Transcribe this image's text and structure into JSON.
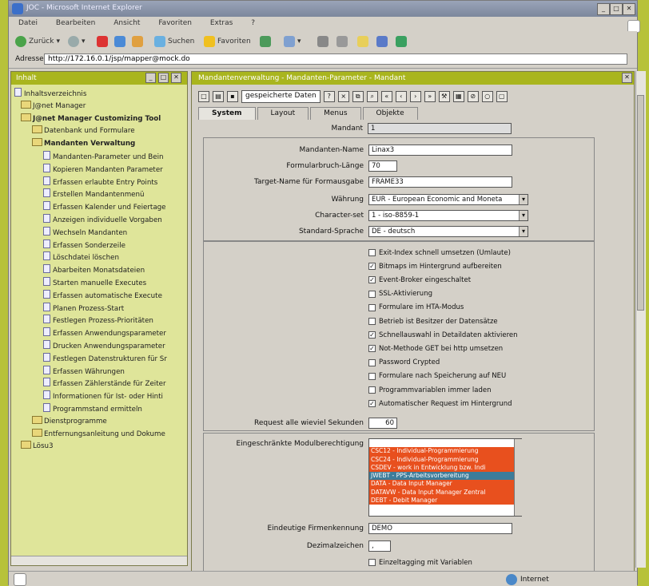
{
  "window": {
    "title": "JOC - Microsoft Internet Explorer"
  },
  "menu": [
    "Datei",
    "Bearbeiten",
    "Ansicht",
    "Favoriten",
    "Extras",
    "?"
  ],
  "toolbar": {
    "back": "Zurück",
    "search": "Suchen",
    "favorites": "Favoriten"
  },
  "address": {
    "label": "Adresse",
    "url": "http://172.16.0.1/jsp/mapper@mock.do"
  },
  "left_pane": {
    "title": "Inhalt",
    "tree": [
      {
        "label": "Inhaltsverzeichnis",
        "level": 0,
        "bold": false,
        "kind": "doc"
      },
      {
        "label": "J@net Manager",
        "level": 0,
        "bold": false,
        "kind": "folder"
      },
      {
        "label": "J@net Manager Customizing Tool",
        "level": 0,
        "bold": true,
        "kind": "folder"
      },
      {
        "label": "Datenbank und Formulare",
        "level": 1,
        "bold": false,
        "kind": "folder"
      },
      {
        "label": "Mandanten Verwaltung",
        "level": 1,
        "bold": true,
        "kind": "folder"
      },
      {
        "label": "Mandanten-Parameter und Bein",
        "level": 2,
        "bold": false,
        "kind": "doc"
      },
      {
        "label": "Kopieren Mandanten Parameter",
        "level": 2,
        "bold": false,
        "kind": "doc"
      },
      {
        "label": "Erfassen erlaubte Entry Points",
        "level": 2,
        "bold": false,
        "kind": "doc"
      },
      {
        "label": "Erstellen Mandantenmenü",
        "level": 2,
        "bold": false,
        "kind": "doc"
      },
      {
        "label": "Erfassen Kalender und Feiertage",
        "level": 2,
        "bold": false,
        "kind": "doc"
      },
      {
        "label": "Anzeigen individuelle Vorgaben",
        "level": 2,
        "bold": false,
        "kind": "doc"
      },
      {
        "label": "Wechseln Mandanten",
        "level": 2,
        "bold": false,
        "kind": "doc"
      },
      {
        "label": "Erfassen Sonderzeile",
        "level": 2,
        "bold": false,
        "kind": "doc"
      },
      {
        "label": "Löschdatei löschen",
        "level": 2,
        "bold": false,
        "kind": "doc"
      },
      {
        "label": "Abarbeiten Monatsdateien",
        "level": 2,
        "bold": false,
        "kind": "doc"
      },
      {
        "label": "Starten manuelle Executes",
        "level": 2,
        "bold": false,
        "kind": "doc"
      },
      {
        "label": "Erfassen automatische Execute",
        "level": 2,
        "bold": false,
        "kind": "doc"
      },
      {
        "label": "Planen Prozess-Start",
        "level": 2,
        "bold": false,
        "kind": "doc"
      },
      {
        "label": "Festlegen Prozess-Prioritäten",
        "level": 2,
        "bold": false,
        "kind": "doc"
      },
      {
        "label": "Erfassen Anwendungsparameter",
        "level": 2,
        "bold": false,
        "kind": "doc"
      },
      {
        "label": "Drucken Anwendungsparameter",
        "level": 2,
        "bold": false,
        "kind": "doc"
      },
      {
        "label": "Festlegen Datenstrukturen für Sr",
        "level": 2,
        "bold": false,
        "kind": "doc"
      },
      {
        "label": "Erfassen Währungen",
        "level": 2,
        "bold": false,
        "kind": "doc"
      },
      {
        "label": "Erfassen Zählerstände für Zeiter",
        "level": 2,
        "bold": false,
        "kind": "doc"
      },
      {
        "label": "Informationen für Ist- oder Hinti",
        "level": 2,
        "bold": false,
        "kind": "doc"
      },
      {
        "label": "Programmstand ermitteln",
        "level": 2,
        "bold": false,
        "kind": "doc"
      },
      {
        "label": "Dienstprogramme",
        "level": 1,
        "bold": false,
        "kind": "folder"
      },
      {
        "label": "Entfernungsanleitung und Dokume",
        "level": 1,
        "bold": false,
        "kind": "folder"
      },
      {
        "label": "Lösu3",
        "level": 0,
        "bold": false,
        "kind": "folder"
      }
    ]
  },
  "right_pane": {
    "title": "Mandantenverwaltung - Mandanten-Parameter - Mandant",
    "toolbar_field": "gespeicherte Daten",
    "tabs": [
      "System",
      "Layout",
      "Menus",
      "Objekte"
    ],
    "fields": {
      "mandant": {
        "label": "Mandant",
        "value": "1"
      },
      "mandanten_name": {
        "label": "Mandanten-Name",
        "value": "Linax3"
      },
      "formularbruch": {
        "label": "Formularbruch-Länge",
        "value": "70"
      },
      "target_name": {
        "label": "Target-Name für Formausgabe",
        "value": "FRAME33"
      },
      "waehrung": {
        "label": "Währung",
        "value": "EUR - European Economic and Moneta"
      },
      "character_set": {
        "label": "Character-set",
        "value": "1 - iso-8859-1"
      },
      "standard_sprache": {
        "label": "Standard-Sprache",
        "value": "DE - deutsch"
      }
    },
    "checkboxes": [
      {
        "label": "Exit-Index schnell umsetzen (Umlaute)",
        "checked": false
      },
      {
        "label": "Bitmaps im Hintergrund aufbereiten",
        "checked": true
      },
      {
        "label": "Event-Broker eingeschaltet",
        "checked": true
      },
      {
        "label": "SSL-Aktivierung",
        "checked": false
      },
      {
        "label": "Formulare im HTA-Modus",
        "checked": false
      },
      {
        "label": "Betrieb ist Besitzer der Datensätze",
        "checked": false
      },
      {
        "label": "Schnellauswahl in Detaildaten aktivieren",
        "checked": true
      },
      {
        "label": "Not-Methode GET bei http umsetzen",
        "checked": true
      },
      {
        "label": "Password Crypted",
        "checked": false
      },
      {
        "label": "Formulare nach Speicherung auf NEU",
        "checked": false
      },
      {
        "label": "Programmvariablen immer laden",
        "checked": false
      },
      {
        "label": "Automatischer Request im Hintergrund",
        "checked": true
      }
    ],
    "request": {
      "label": "Request alle wieviel Sekunden",
      "value": "60"
    },
    "module": {
      "label": "Eingeschränkte Modulberechtigung",
      "items": [
        {
          "text": "",
          "style": "white"
        },
        {
          "text": "CSC12 - Individual-Programmierung",
          "style": "orange"
        },
        {
          "text": "CSC24 - Individual-Programmierung",
          "style": "orange"
        },
        {
          "text": "CSDEV - work in Entwicklung bzw. Indi",
          "style": "orange"
        },
        {
          "text": "JWEBT - PPS-Arbeitsvorbereitung",
          "style": "selected"
        },
        {
          "text": "DATA - Data Input Manager",
          "style": "orange"
        },
        {
          "text": "DATAVW - Data Input Manager Zentral",
          "style": "orange"
        },
        {
          "text": "DEBT - Debit Manager",
          "style": "orange"
        }
      ]
    },
    "eindeutige": {
      "label": "Eindeutige Firmenkennung",
      "value": "DEMO"
    },
    "dezimal": {
      "label": "Dezimalzeichen",
      "value": ","
    },
    "last_checkbox": {
      "label": "Einzeltagging mit Variablen",
      "checked": false
    }
  },
  "status": {
    "zone": "Internet"
  }
}
